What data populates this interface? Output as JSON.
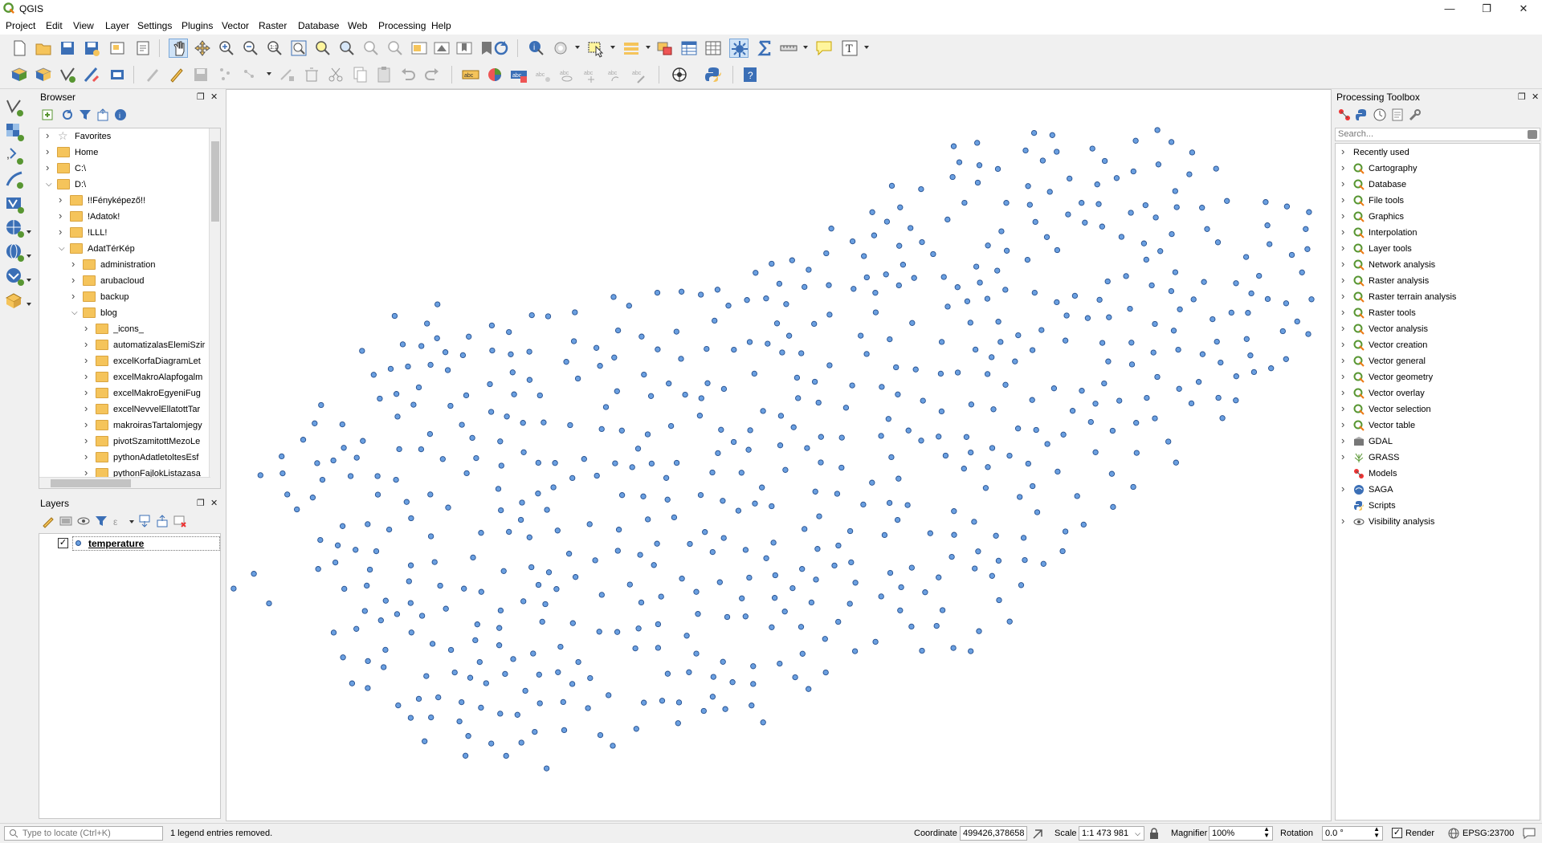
{
  "window": {
    "title": "QGIS",
    "minimize_icon": "minimize-icon",
    "maximize_icon": "restore-icon",
    "close_icon": "close-icon"
  },
  "menubar": [
    "Project",
    "Edit",
    "View",
    "Layer",
    "Settings",
    "Plugins",
    "Vector",
    "Raster",
    "Database",
    "Web",
    "Processing",
    "Help"
  ],
  "browser": {
    "title": "Browser",
    "items": [
      {
        "label": "Favorites",
        "level": 0,
        "expanded": false,
        "icon": "star-icon"
      },
      {
        "label": "Home",
        "level": 0,
        "expanded": false,
        "icon": "folder-icon"
      },
      {
        "label": "C:\\",
        "level": 0,
        "expanded": false,
        "icon": "folder-icon"
      },
      {
        "label": "D:\\",
        "level": 0,
        "expanded": true,
        "icon": "folder-icon"
      },
      {
        "label": "!!Fényképező!!",
        "level": 1,
        "expanded": false,
        "icon": "folder-icon"
      },
      {
        "label": "!Adatok!",
        "level": 1,
        "expanded": false,
        "icon": "folder-icon"
      },
      {
        "label": "!LLL!",
        "level": 1,
        "expanded": false,
        "icon": "folder-icon"
      },
      {
        "label": "AdatTérKép",
        "level": 1,
        "expanded": true,
        "icon": "folder-icon"
      },
      {
        "label": "administration",
        "level": 2,
        "expanded": false,
        "icon": "folder-icon"
      },
      {
        "label": "arubacloud",
        "level": 2,
        "expanded": false,
        "icon": "folder-icon"
      },
      {
        "label": "backup",
        "level": 2,
        "expanded": false,
        "icon": "folder-icon"
      },
      {
        "label": "blog",
        "level": 2,
        "expanded": true,
        "icon": "folder-icon"
      },
      {
        "label": "_icons_",
        "level": 3,
        "expanded": false,
        "icon": "folder-icon"
      },
      {
        "label": "automatizalasElemiSzir",
        "level": 3,
        "expanded": false,
        "icon": "folder-icon"
      },
      {
        "label": "excelKorfaDiagramLet",
        "level": 3,
        "expanded": false,
        "icon": "folder-icon"
      },
      {
        "label": "excelMakroAlapfogalm",
        "level": 3,
        "expanded": false,
        "icon": "folder-icon"
      },
      {
        "label": "excelMakroEgyeniFug",
        "level": 3,
        "expanded": false,
        "icon": "folder-icon"
      },
      {
        "label": "excelNevvelEllatottTar",
        "level": 3,
        "expanded": false,
        "icon": "folder-icon"
      },
      {
        "label": "makroirasTartalomjegy",
        "level": 3,
        "expanded": false,
        "icon": "folder-icon"
      },
      {
        "label": "pivotSzamitottMezoLe",
        "level": 3,
        "expanded": false,
        "icon": "folder-icon"
      },
      {
        "label": "pythonAdatletoltesEsf",
        "level": 3,
        "expanded": false,
        "icon": "folder-icon"
      },
      {
        "label": "pythonFajlokListazasa",
        "level": 3,
        "expanded": false,
        "icon": "folder-icon"
      }
    ]
  },
  "layers": {
    "title": "Layers",
    "items": [
      {
        "name": "temperature",
        "visible": true,
        "symbol_color": "#6a9fe0"
      }
    ]
  },
  "map": {
    "point_fill": "#6a9fe0",
    "point_stroke": "#244f8f",
    "background": "#ffffff"
  },
  "toolbox": {
    "title": "Processing Toolbox",
    "search_placeholder": "Search...",
    "items": [
      {
        "label": "Recently used",
        "icon": "none"
      },
      {
        "label": "Cartography",
        "icon": "qgis-icon"
      },
      {
        "label": "Database",
        "icon": "qgis-icon"
      },
      {
        "label": "File tools",
        "icon": "qgis-icon"
      },
      {
        "label": "Graphics",
        "icon": "qgis-icon"
      },
      {
        "label": "Interpolation",
        "icon": "qgis-icon"
      },
      {
        "label": "Layer tools",
        "icon": "qgis-icon"
      },
      {
        "label": "Network analysis",
        "icon": "qgis-icon"
      },
      {
        "label": "Raster analysis",
        "icon": "qgis-icon"
      },
      {
        "label": "Raster terrain analysis",
        "icon": "qgis-icon"
      },
      {
        "label": "Raster tools",
        "icon": "qgis-icon"
      },
      {
        "label": "Vector analysis",
        "icon": "qgis-icon"
      },
      {
        "label": "Vector creation",
        "icon": "qgis-icon"
      },
      {
        "label": "Vector general",
        "icon": "qgis-icon"
      },
      {
        "label": "Vector geometry",
        "icon": "qgis-icon"
      },
      {
        "label": "Vector overlay",
        "icon": "qgis-icon"
      },
      {
        "label": "Vector selection",
        "icon": "qgis-icon"
      },
      {
        "label": "Vector table",
        "icon": "qgis-icon"
      },
      {
        "label": "GDAL",
        "icon": "gdal-icon"
      },
      {
        "label": "GRASS",
        "icon": "grass-icon"
      },
      {
        "label": "Models",
        "icon": "models-icon"
      },
      {
        "label": "SAGA",
        "icon": "saga-icon"
      },
      {
        "label": "Scripts",
        "icon": "python-icon"
      },
      {
        "label": "Visibility analysis",
        "icon": "eye-icon"
      }
    ]
  },
  "statusbar": {
    "locator_placeholder": "Type to locate (Ctrl+K)",
    "message": "1 legend entries removed.",
    "coordinate_label": "Coordinate",
    "coordinate_value": "499426,378658",
    "scale_label": "Scale",
    "scale_value": "1:1 473 981",
    "magnifier_label": "Magnifier",
    "magnifier_value": "100%",
    "rotation_label": "Rotation",
    "rotation_value": "0.0 °",
    "render_label": "Render",
    "render_checked": true,
    "crs_label": "EPSG:23700"
  }
}
